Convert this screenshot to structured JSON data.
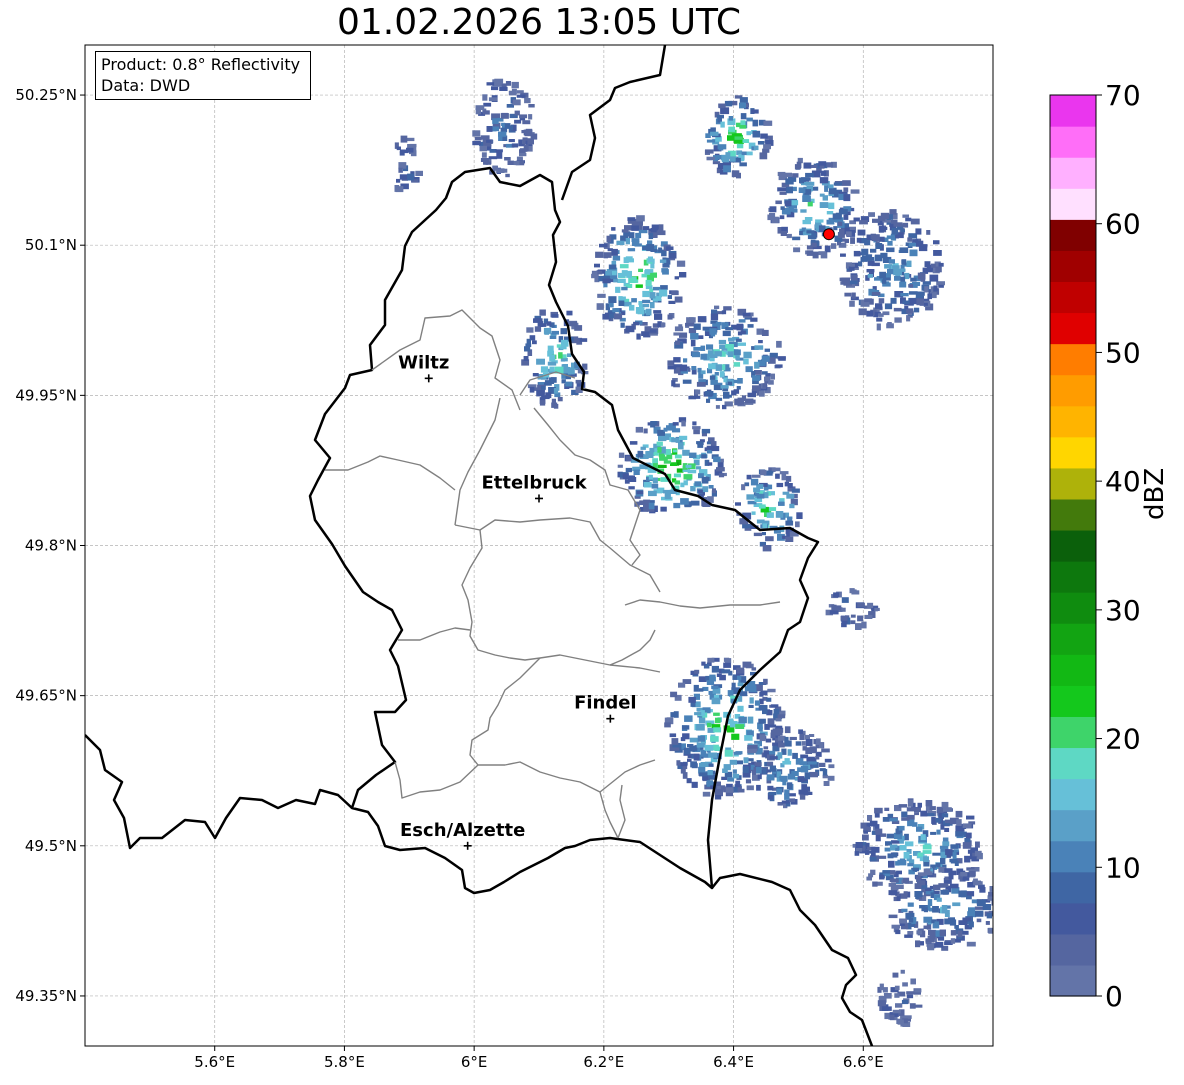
{
  "title": "01.02.2026 13:05 UTC",
  "info": {
    "product_line": "Product: 0.8° Reflectivity",
    "data_line": "Data: DWD"
  },
  "map": {
    "lon_range": [
      5.4,
      6.8
    ],
    "lat_range": [
      49.3,
      50.3
    ],
    "lon_ticks": [
      {
        "value": 5.6,
        "label": "5.6°E"
      },
      {
        "value": 5.8,
        "label": "5.8°E"
      },
      {
        "value": 6.0,
        "label": "6°E"
      },
      {
        "value": 6.2,
        "label": "6.2°E"
      },
      {
        "value": 6.4,
        "label": "6.4°E"
      },
      {
        "value": 6.6,
        "label": "6.6°E"
      }
    ],
    "lat_ticks": [
      {
        "value": 50.25,
        "label": "50.25°N"
      },
      {
        "value": 50.1,
        "label": "50.1°N"
      },
      {
        "value": 49.95,
        "label": "49.95°N"
      },
      {
        "value": 49.8,
        "label": "49.8°N"
      },
      {
        "value": 49.65,
        "label": "49.65°N"
      },
      {
        "value": 49.5,
        "label": "49.5°N"
      },
      {
        "value": 49.35,
        "label": "49.35°N"
      }
    ],
    "cities": [
      {
        "name": "Wiltz",
        "lon": 5.93,
        "lat": 49.967
      },
      {
        "name": "Ettelbruck",
        "lon": 6.1,
        "lat": 49.847
      },
      {
        "name": "Findel",
        "lon": 6.21,
        "lat": 49.627
      },
      {
        "name": "Esch/Alzette",
        "lon": 5.99,
        "lat": 49.5
      }
    ],
    "radar_site": {
      "lon": 6.547,
      "lat": 50.111,
      "color": "#ff0000"
    }
  },
  "colorbar": {
    "label": "dBZ",
    "min": 0,
    "max": 70,
    "ticks": [
      {
        "value": 0,
        "label": "0"
      },
      {
        "value": 10,
        "label": "10"
      },
      {
        "value": 20,
        "label": "20"
      },
      {
        "value": 30,
        "label": "30"
      },
      {
        "value": 40,
        "label": "40"
      },
      {
        "value": 50,
        "label": "50"
      },
      {
        "value": 60,
        "label": "60"
      },
      {
        "value": 70,
        "label": "70"
      }
    ],
    "colors": [
      "#6374a8",
      "#5566a0",
      "#43599e",
      "#3f66a4",
      "#4a82b8",
      "#5aa0c8",
      "#66c0d8",
      "#5ed8c4",
      "#3ed46a",
      "#14c81c",
      "#12b814",
      "#12a412",
      "#0f8c0f",
      "#0d780d",
      "#0b600b",
      "#437a0c",
      "#aeb20a",
      "#ffd600",
      "#ffb400",
      "#ff9c00",
      "#ff7d00",
      "#e00000",
      "#c00000",
      "#a00000",
      "#800000",
      "#ffe0ff",
      "#ffb0ff",
      "#ff6ef8",
      "#ea36ee"
    ]
  },
  "precip_clusters": [
    {
      "lon": 6.4,
      "lat": 50.21,
      "rx": 0.05,
      "ry": 0.04,
      "core": 24
    },
    {
      "lon": 6.52,
      "lat": 50.14,
      "rx": 0.07,
      "ry": 0.05,
      "core": 18
    },
    {
      "lon": 6.64,
      "lat": 50.08,
      "rx": 0.08,
      "ry": 0.06,
      "core": 14
    },
    {
      "lon": 6.25,
      "lat": 50.07,
      "rx": 0.07,
      "ry": 0.06,
      "core": 22
    },
    {
      "lon": 6.38,
      "lat": 49.99,
      "rx": 0.09,
      "ry": 0.05,
      "core": 18
    },
    {
      "lon": 6.3,
      "lat": 49.88,
      "rx": 0.08,
      "ry": 0.05,
      "core": 26
    },
    {
      "lon": 6.45,
      "lat": 49.84,
      "rx": 0.05,
      "ry": 0.04,
      "core": 22
    },
    {
      "lon": 6.12,
      "lat": 49.99,
      "rx": 0.05,
      "ry": 0.05,
      "core": 20
    },
    {
      "lon": 6.38,
      "lat": 49.62,
      "rx": 0.09,
      "ry": 0.07,
      "core": 22
    },
    {
      "lon": 6.48,
      "lat": 49.58,
      "rx": 0.07,
      "ry": 0.04,
      "core": 14
    },
    {
      "lon": 6.68,
      "lat": 49.5,
      "rx": 0.1,
      "ry": 0.05,
      "core": 16
    },
    {
      "lon": 6.72,
      "lat": 49.44,
      "rx": 0.09,
      "ry": 0.04,
      "core": 14
    },
    {
      "lon": 6.04,
      "lat": 50.22,
      "rx": 0.05,
      "ry": 0.05,
      "core": 10
    },
    {
      "lon": 5.89,
      "lat": 50.18,
      "rx": 0.02,
      "ry": 0.03,
      "core": 8
    },
    {
      "lon": 6.65,
      "lat": 49.35,
      "rx": 0.03,
      "ry": 0.03,
      "core": 6
    },
    {
      "lon": 6.58,
      "lat": 49.74,
      "rx": 0.04,
      "ry": 0.02,
      "core": 8
    }
  ]
}
